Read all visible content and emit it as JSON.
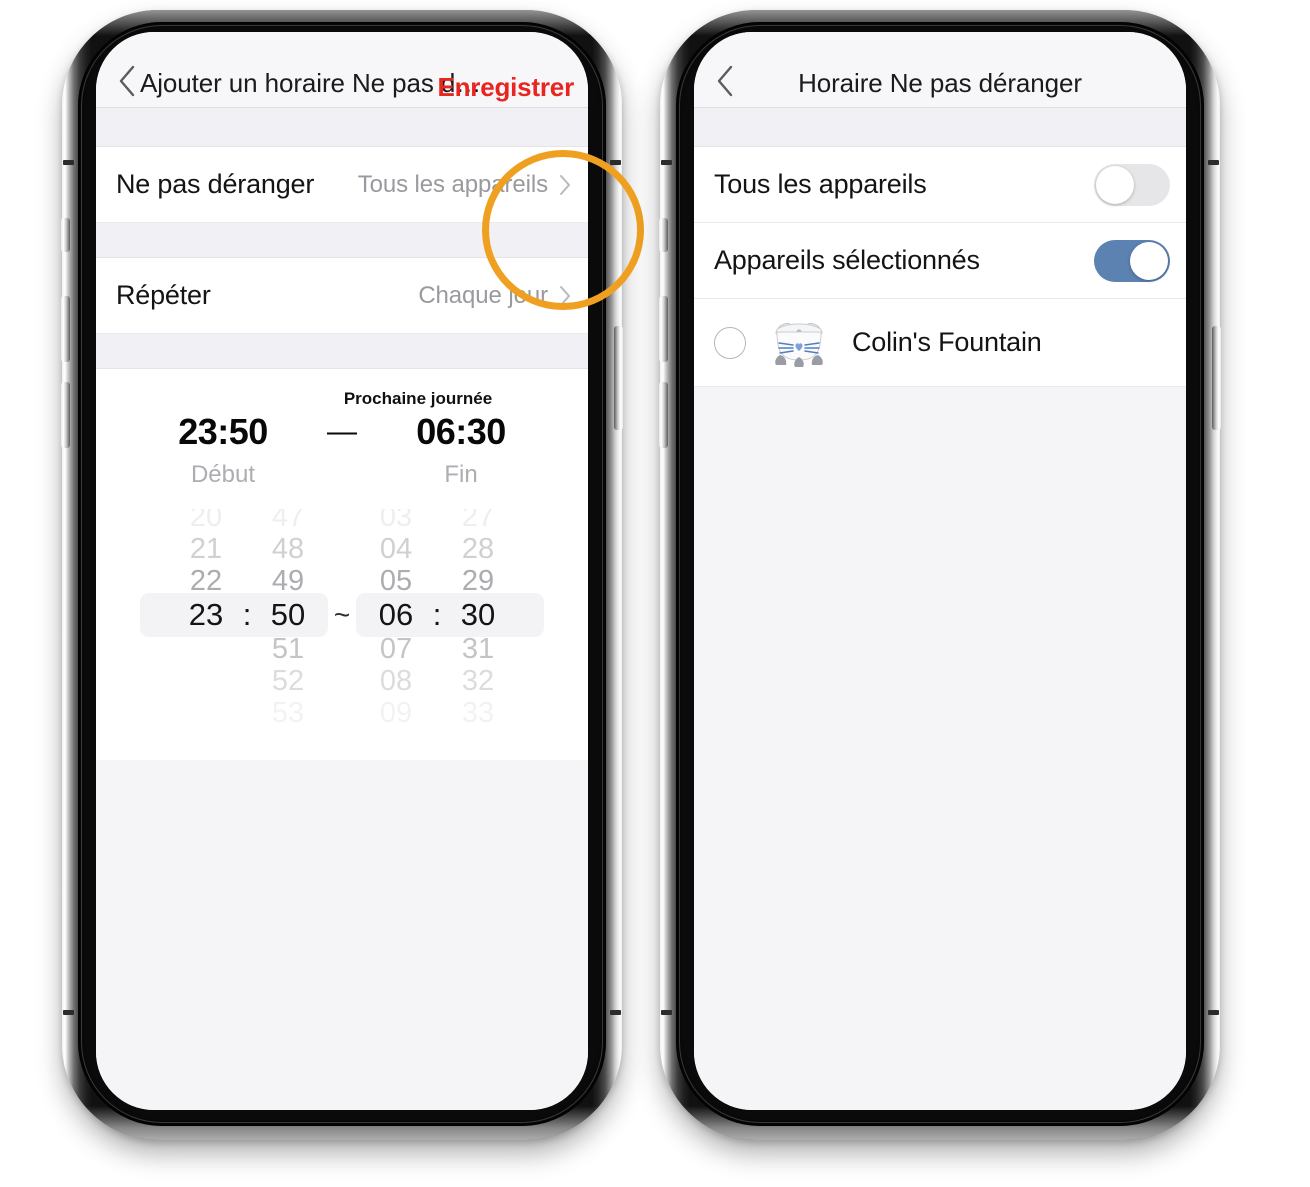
{
  "meta": {
    "accent_orange": "#efa020",
    "accent_red": "#e8251f",
    "toggle_on_blue": "#5b82b0",
    "screen_bg": "#f5f5f8"
  },
  "phone_left": {
    "nav": {
      "back_icon": "chevron-left-icon",
      "title": "Ajouter un horaire Ne pas d…",
      "action_label": "Enregistrer"
    },
    "rows": [
      {
        "label": "Ne pas déranger",
        "value": "Tous les appareils",
        "chevron": "chevron-right-icon"
      },
      {
        "label": "Répéter",
        "value": "Chaque jour",
        "chevron": "chevron-right-icon"
      }
    ],
    "time_picker": {
      "next_day_label": "Prochaine journée",
      "start_time": "23:50",
      "dash": "—",
      "end_time": "06:30",
      "start_caption": "Début",
      "end_caption": "Fin",
      "range_separator": "~",
      "colon": ":",
      "start_hours": [
        "20",
        "21",
        "22",
        "23",
        "",
        "",
        ""
      ],
      "start_minutes": [
        "47",
        "48",
        "49",
        "50",
        "51",
        "52",
        "53"
      ],
      "end_hours": [
        "03",
        "04",
        "05",
        "06",
        "07",
        "08",
        "09"
      ],
      "end_minutes": [
        "27",
        "28",
        "29",
        "30",
        "31",
        "32",
        "33"
      ],
      "selected_start_hour": "23",
      "selected_start_minute": "50",
      "selected_end_hour": "06",
      "selected_end_minute": "30"
    },
    "annotation": {
      "shape": "circle-highlight",
      "color": "#efa020",
      "targets": "Tous les appareils"
    }
  },
  "phone_right": {
    "nav": {
      "back_icon": "chevron-left-icon",
      "title": "Horaire Ne pas déranger"
    },
    "toggles": [
      {
        "label": "Tous les appareils",
        "state": "off"
      },
      {
        "label": "Appareils sélectionnés",
        "state": "on"
      }
    ],
    "devices": [
      {
        "name": "Colin's Fountain",
        "selected": false,
        "icon": "cat-fountain-icon"
      }
    ]
  }
}
